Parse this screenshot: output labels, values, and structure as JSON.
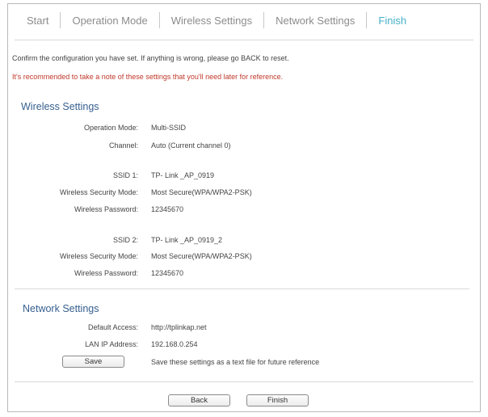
{
  "tabs": [
    {
      "label": "Start",
      "active": false
    },
    {
      "label": "Operation Mode",
      "active": false
    },
    {
      "label": "Wireless Settings",
      "active": false
    },
    {
      "label": "Network Settings",
      "active": false
    },
    {
      "label": "Finish",
      "active": true
    }
  ],
  "messages": {
    "confirm": "Confirm the configuration you have set. If anything is wrong, please go BACK to reset.",
    "recommend": "It's recommended to take a note of these settings that you'll need later for reference."
  },
  "wireless": {
    "title": "Wireless Settings",
    "operation_mode": {
      "label": "Operation Mode:",
      "value": "Multi-SSID"
    },
    "channel": {
      "label": "Channel:",
      "value": "Auto (Current channel 0)"
    },
    "ssid1": {
      "label": "SSID 1:",
      "value": "TP- Link _AP_0919"
    },
    "security1": {
      "label": "Wireless Security Mode:",
      "value": "Most Secure(WPA/WPA2-PSK)"
    },
    "password1": {
      "label": "Wireless Password:",
      "value": "12345670"
    },
    "ssid2": {
      "label": "SSID 2:",
      "value": "TP- Link _AP_0919_2"
    },
    "security2": {
      "label": "Wireless Security Mode:",
      "value": "Most Secure(WPA/WPA2-PSK)"
    },
    "password2": {
      "label": "Wireless Password:",
      "value": "12345670"
    }
  },
  "network": {
    "title": "Network Settings",
    "default_access": {
      "label": "Default Access:",
      "value": "http://tplinkap.net"
    },
    "lan_ip": {
      "label": "LAN IP Address:",
      "value": "192.168.0.254"
    },
    "save_label": "Save",
    "save_note": "Save these settings as a text file for future reference"
  },
  "footer": {
    "back_label": "Back",
    "finish_label": "Finish"
  },
  "colors": {
    "active_tab": "#47b1c9",
    "section_title": "#365f8f",
    "warning": "#c0392b"
  }
}
